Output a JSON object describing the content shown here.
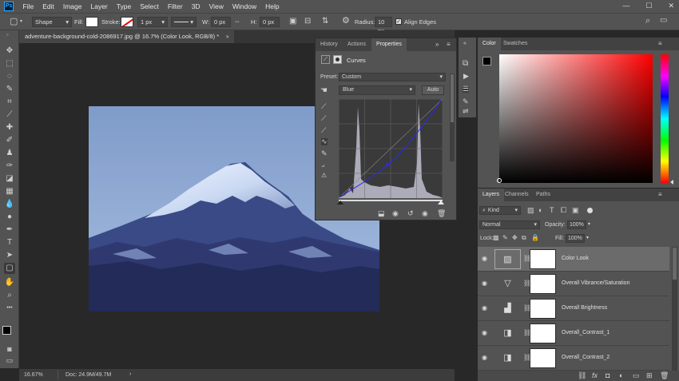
{
  "app": {
    "logo": "Ps"
  },
  "menubar": {
    "items": [
      "File",
      "Edit",
      "Image",
      "Layer",
      "Type",
      "Select",
      "Filter",
      "3D",
      "View",
      "Window",
      "Help"
    ]
  },
  "window_controls": {
    "minimize": "—",
    "maximize": "☐",
    "close": "✕"
  },
  "options_bar": {
    "shape_mode": "Shape",
    "fill_label": "Fill:",
    "stroke_label": "Stroke:",
    "stroke_width": "1 px",
    "w_label": "W:",
    "w_value": "0 px",
    "h_label": "H:",
    "h_value": "0 px",
    "radius_label": "Radius:",
    "radius_value": "10 px",
    "align_edges_label": "Align Edges",
    "align_edges_checked": true
  },
  "document": {
    "tab_title": "adventure-background-cold-2086917.jpg @ 16.7% (Color Look, RGB/8) *",
    "tab_close": "✕"
  },
  "status_bar": {
    "zoom": "16.67%",
    "doc_info": "Doc: 24.9M/49.7M",
    "arrow": "›"
  },
  "properties": {
    "tabs": [
      "History",
      "Actions",
      "Properties"
    ],
    "active_tab": "Properties",
    "title": "Curves",
    "preset_label": "Preset:",
    "preset_value": "Custom",
    "channel_value": "Blue",
    "auto_label": "Auto"
  },
  "color_panel": {
    "tabs": [
      "Color",
      "Swatches"
    ],
    "active_tab": "Color",
    "fg_color": "#000000",
    "bg_color": "#ffffff",
    "hue_color": "#ff0000"
  },
  "layers_panel": {
    "tabs": [
      "Layers",
      "Channels",
      "Paths"
    ],
    "active_tab": "Layers",
    "filter_kind": "Kind",
    "blend_mode": "Normal",
    "opacity_label": "Opacity:",
    "opacity_value": "100%",
    "lock_label": "Lock:",
    "fill_label": "Fill:",
    "fill_value": "100%",
    "layers": [
      {
        "name": "Color Look",
        "icon": "curves-adjustment-icon",
        "glyph": "▨",
        "selected": true
      },
      {
        "name": "Overall Vibrance/Saturation",
        "icon": "vibrance-adjustment-icon",
        "glyph": "▽",
        "selected": false
      },
      {
        "name": "Overall Brightness",
        "icon": "levels-adjustment-icon",
        "glyph": "▟",
        "selected": false
      },
      {
        "name": "Overall_Contrast_1",
        "icon": "brightness-contrast-icon",
        "glyph": "◨",
        "selected": false
      },
      {
        "name": "Overall_Contrast_2",
        "icon": "brightness-contrast-icon",
        "glyph": "◨",
        "selected": false
      }
    ]
  }
}
